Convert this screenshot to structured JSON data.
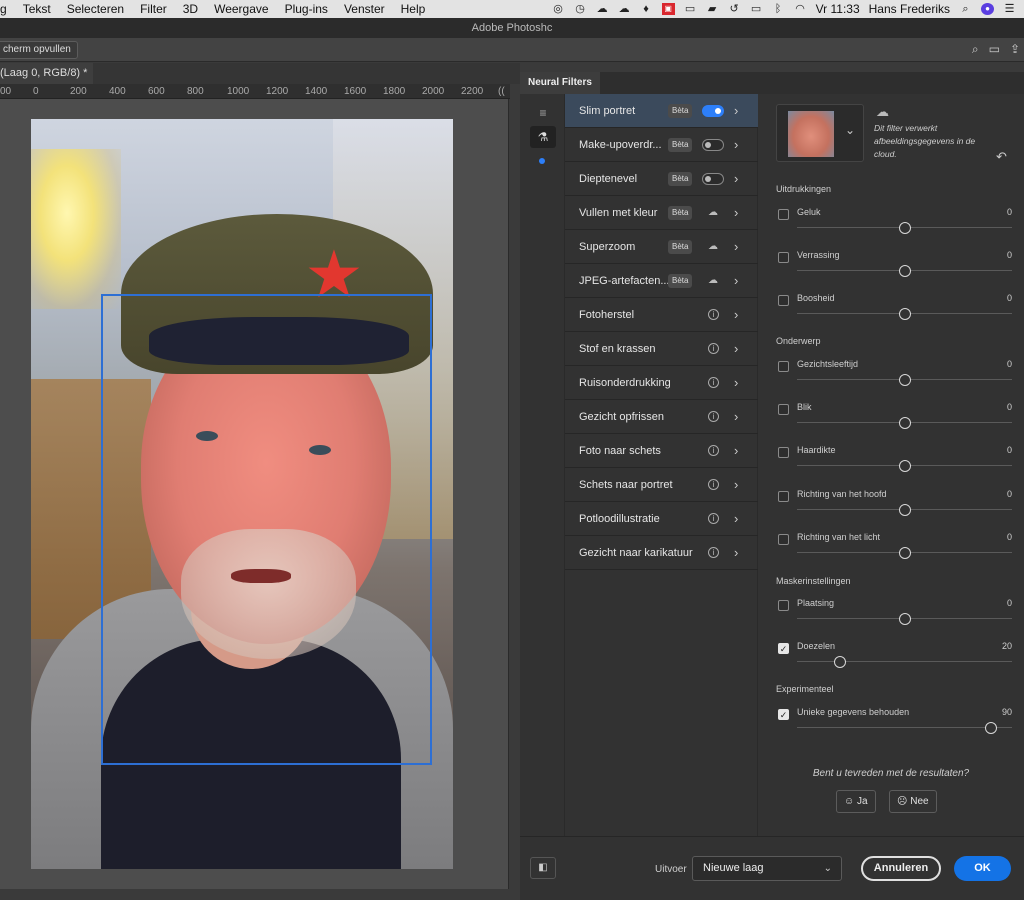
{
  "menubar": {
    "items": [
      "g",
      "Tekst",
      "Selecteren",
      "Filter",
      "3D",
      "Weergave",
      "Plug-ins",
      "Venster",
      "Help"
    ],
    "clock": "Vr 11:33",
    "user": "Hans Frederiks"
  },
  "window": {
    "title": "Adobe Photoshc"
  },
  "options": {
    "fill_label": "cherm opvullen"
  },
  "document": {
    "tab_label": "(Laag 0, RGB/8) *",
    "ruler_ticks": [
      "00",
      "0",
      "200",
      "400",
      "600",
      "800",
      "1000",
      "1200",
      "1400",
      "1600",
      "1800",
      "2000",
      "2200",
      "(("
    ]
  },
  "panel": {
    "tab": "Neural Filters",
    "filters": [
      {
        "name": "Slim portret",
        "badge": "Bèta",
        "control": "toggle-on",
        "selected": true
      },
      {
        "name": "Make-upoverdr...",
        "badge": "Bèta",
        "control": "toggle-off"
      },
      {
        "name": "Dieptenevel",
        "badge": "Bèta",
        "control": "toggle-off"
      },
      {
        "name": "Vullen met kleur",
        "badge": "Bèta",
        "control": "cloud"
      },
      {
        "name": "Superzoom",
        "badge": "Bèta",
        "control": "cloud"
      },
      {
        "name": "JPEG-artefacten...",
        "badge": "Bèta",
        "control": "cloud"
      },
      {
        "name": "Fotoherstel",
        "badge": "",
        "control": "info"
      },
      {
        "name": "Stof en krassen",
        "badge": "",
        "control": "info"
      },
      {
        "name": "Ruisonderdrukking",
        "badge": "",
        "control": "info"
      },
      {
        "name": "Gezicht opfrissen",
        "badge": "",
        "control": "info"
      },
      {
        "name": "Foto naar schets",
        "badge": "",
        "control": "info"
      },
      {
        "name": "Schets naar portret",
        "badge": "",
        "control": "info"
      },
      {
        "name": "Potloodillustratie",
        "badge": "",
        "control": "info"
      },
      {
        "name": "Gezicht naar karikatuur",
        "badge": "",
        "control": "info"
      }
    ],
    "cloud_note": "Dit filter verwerkt afbeeldingsgegevens in de cloud.",
    "sections": {
      "expressions": "Uitdrukkingen",
      "subject": "Onderwerp",
      "mask": "Maskerinstellingen",
      "experimental": "Experimenteel"
    },
    "sliders": [
      {
        "label": "Geluk",
        "value": "0",
        "checked": false,
        "level": 0.5
      },
      {
        "label": "Verrassing",
        "value": "0",
        "checked": false,
        "level": 0.5
      },
      {
        "label": "Boosheid",
        "value": "0",
        "checked": false,
        "level": 0.5
      },
      {
        "label": "Gezichtsleeftijd",
        "value": "0",
        "checked": false,
        "level": 0.5
      },
      {
        "label": "Blik",
        "value": "0",
        "checked": false,
        "level": 0.5
      },
      {
        "label": "Haardikte",
        "value": "0",
        "checked": false,
        "level": 0.5
      },
      {
        "label": "Richting van het hoofd",
        "value": "0",
        "checked": false,
        "level": 0.5
      },
      {
        "label": "Richting van het licht",
        "value": "0",
        "checked": false,
        "level": 0.5
      },
      {
        "label": "Plaatsing",
        "value": "0",
        "checked": false,
        "level": 0.5
      },
      {
        "label": "Doezelen",
        "value": "20",
        "checked": true,
        "level": 0.2
      },
      {
        "label": "Unieke gegevens behouden",
        "value": "90",
        "checked": true,
        "level": 0.9
      }
    ],
    "feedback": {
      "question": "Bent u tevreden met de resultaten?",
      "yes": "Ja",
      "no": "Nee"
    },
    "footer": {
      "output_label": "Uitvoer",
      "output_value": "Nieuwe laag",
      "cancel": "Annuleren",
      "ok": "OK"
    }
  },
  "colors": {
    "accent": "#1473e6",
    "toggle_on": "#2d7ff9",
    "face_box": "#2d6fd4"
  }
}
